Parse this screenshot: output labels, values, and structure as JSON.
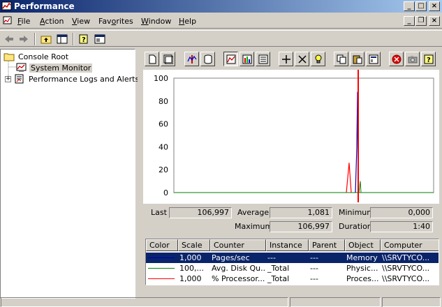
{
  "window": {
    "title": "Performance",
    "minimize": "_",
    "maximize": "□",
    "close": "×"
  },
  "menu": {
    "items": [
      {
        "label": "File",
        "mnemonic": "F",
        "rest": "ile"
      },
      {
        "label": "Action",
        "mnemonic": "A",
        "rest": "ction"
      },
      {
        "label": "View",
        "mnemonic": "V",
        "rest": "iew"
      },
      {
        "label": "Favorites",
        "pre": "Fav",
        "mnemonic": "o",
        "rest": "rites"
      },
      {
        "label": "Window",
        "mnemonic": "W",
        "rest": "indow"
      },
      {
        "label": "Help",
        "mnemonic": "H",
        "rest": "elp"
      }
    ],
    "mdi_minimize": "_",
    "mdi_restore": "❐",
    "mdi_close": "×"
  },
  "tree": {
    "items": [
      {
        "label": "Console Root",
        "icon": "folder-icon"
      },
      {
        "label": "System Monitor",
        "icon": "system-monitor-icon",
        "selected": true
      },
      {
        "label": "Performance Logs and Alerts",
        "icon": "logs-alerts-icon",
        "expander": "+"
      }
    ]
  },
  "graph": {
    "y_ticks": [
      "100",
      "80",
      "60",
      "40",
      "20",
      "0"
    ],
    "ylim": [
      0,
      100
    ],
    "line_color": "#ff0000",
    "series_colors": {
      "pages_sec": "#0000c0",
      "disk_queue": "#008000",
      "processor": "#ff0000"
    },
    "spike_blue_max": 88,
    "spike_red_max": 26
  },
  "stats": {
    "last_label": "Last",
    "last_value": "106,997",
    "average_label": "Average",
    "average_value": "1,081",
    "minimum_label": "Minimum",
    "minimum_value": "0,000",
    "maximum_label": "Maximum",
    "maximum_value": "106,997",
    "duration_label": "Duration",
    "duration_value": "1:40"
  },
  "counters": {
    "columns": [
      "Color",
      "Scale",
      "Counter",
      "Instance",
      "Parent",
      "Object",
      "Computer"
    ],
    "rows": [
      {
        "color": "#0000c0",
        "scale": "1,000",
        "counter": "Pages/sec",
        "instance": "---",
        "parent": "---",
        "object": "Memory",
        "computer": "\\\\SRVTYCO...",
        "selected": true
      },
      {
        "color": "#008000",
        "scale": "100,...",
        "counter": "Avg. Disk Qu...",
        "instance": "_Total",
        "parent": "---",
        "object": "Physic...",
        "computer": "\\\\SRVTYCO..."
      },
      {
        "color": "#ff0000",
        "scale": "1,000",
        "counter": "% Processor...",
        "instance": "_Total",
        "parent": "---",
        "object": "Proces...",
        "computer": "\\\\SRVTYCO..."
      }
    ]
  }
}
